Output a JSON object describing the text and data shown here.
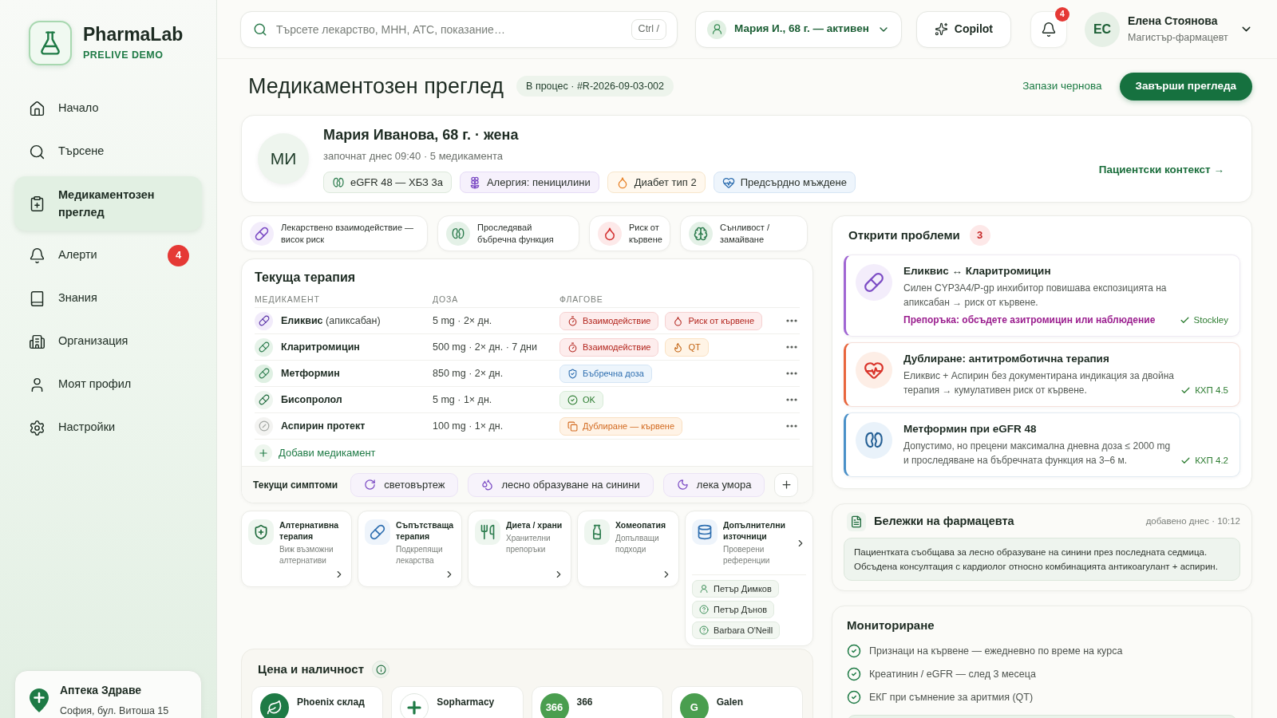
{
  "sidebar": {
    "brand": {
      "name": "PharmaLab",
      "tagline": "PRELIVE DEMO"
    },
    "items": [
      {
        "label": "Начало",
        "selected": false
      },
      {
        "label": "Търсене",
        "selected": false
      },
      {
        "label": "Медикаментозен преглед",
        "selected": true
      },
      {
        "label": "Алерти",
        "selected": false,
        "badge": "4"
      },
      {
        "label": "Знания",
        "selected": false
      },
      {
        "label": "Организация",
        "selected": false
      },
      {
        "label": "Моят профил",
        "selected": false
      },
      {
        "label": "Настройки",
        "selected": false
      }
    ],
    "pharmacy": {
      "name": "Аптека Здраве",
      "address": "София, бул. Витоша 15"
    }
  },
  "topbar": {
    "search": {
      "placeholder": "Търсете лекарство, МНН, АТС, показание…",
      "shortcut": "Ctrl /"
    },
    "patient_selector": "Мария И., 68 г. — активен",
    "copilot": "Copilot",
    "notifications": "4",
    "user": {
      "initials": "ЕС",
      "name": "Елена Стоянова",
      "role": "Магистър-фармацевт"
    }
  },
  "header": {
    "title": "Медикаментозен преглед",
    "status": "В процес · #R-2026-09-03-002",
    "save_draft": "Запази чернова",
    "finish": "Завърши прегледа"
  },
  "patient": {
    "initials": "МИ",
    "name": "Мария Иванова, 68 г. · жена",
    "meta": "започнат днес 09:40 · 5 медикамента",
    "tags": [
      {
        "kind": "renal",
        "label": "eGFR 48 — ХБЗ 3а"
      },
      {
        "kind": "allergy",
        "label": "Алергия: пеницилини"
      },
      {
        "kind": "diabetes",
        "label": "Диабет тип 2"
      },
      {
        "kind": "cardiac",
        "label": "Предсърдно мъждене"
      }
    ],
    "context_link": "Пациентски контекст →"
  },
  "alerts": [
    {
      "kind": "interaction",
      "label": "Лекарствено взаимодействие — висок риск"
    },
    {
      "kind": "renal",
      "label": "Проследявай бъбречна функция"
    },
    {
      "kind": "bleeding",
      "label": "Риск от кървене"
    },
    {
      "kind": "sedation",
      "label": "Сънливост / замайване"
    }
  ],
  "therapy": {
    "title": "Текуща терапия",
    "columns": [
      "МЕДИКАМЕНТ",
      "ДОЗА",
      "ФЛАГОВЕ"
    ],
    "rows": [
      {
        "name": "Еликвис",
        "generic": "(апиксабан)",
        "dose": "5 mg · 2× дн.",
        "flags": [
          {
            "kind": "interaction",
            "label": "Взаимодействие"
          },
          {
            "kind": "bleeding",
            "label": "Риск от кървене"
          }
        ]
      },
      {
        "name": "Кларитромицин",
        "dose": "500 mg · 2× дн. · 7 дни",
        "flags": [
          {
            "kind": "interaction",
            "label": "Взаимодействие"
          },
          {
            "kind": "qt",
            "label": "QT"
          }
        ]
      },
      {
        "name": "Метформин",
        "dose": "850 mg · 2× дн.",
        "flags": [
          {
            "kind": "renal",
            "label": "Бъбречна доза"
          }
        ]
      },
      {
        "name": "Бисопролол",
        "dose": "5 mg · 1× дн.",
        "flags": [
          {
            "kind": "ok",
            "label": "OK"
          }
        ]
      },
      {
        "name": "Аспирин протект",
        "dose": "100 mg · 1× дн.",
        "flags": [
          {
            "kind": "duplicate",
            "label": "Дублиране — кървене"
          }
        ]
      }
    ],
    "add_label": "Добави медикамент",
    "symptoms": {
      "label": "Текущи симптоми",
      "items": [
        {
          "kind": "dizziness",
          "label": "световъртеж"
        },
        {
          "kind": "bruising",
          "label": "лесно образуване на синини"
        },
        {
          "kind": "fatigue",
          "label": "лека умора"
        }
      ]
    }
  },
  "categories": [
    {
      "kind": "alternative",
      "title": "Алтернативна терапия",
      "subtitle": "Виж възможни алтернативи"
    },
    {
      "kind": "supportive",
      "title": "Съпътстваща терапия",
      "subtitle": "Подкрепящи лекарства"
    },
    {
      "kind": "diet",
      "title": "Диета / храни",
      "subtitle": "Хранителни препоръки"
    },
    {
      "kind": "homeopathy",
      "title": "Хомеопатия",
      "subtitle": "Допълващи подходи"
    },
    {
      "kind": "sources",
      "title": "Допълнителни източници",
      "subtitle": "Проверени референции",
      "people": [
        {
          "kind": "person",
          "name": "Петър Димков"
        },
        {
          "kind": "unknown",
          "name": "Петър Дънов"
        },
        {
          "kind": "unknown",
          "name": "Barbara O'Neill"
        }
      ]
    }
  ],
  "pricing": {
    "title": "Цена и наличност",
    "suppliers": [
      {
        "name": "Phoenix склад",
        "logo": {
          "kind": "leaf"
        }
      },
      {
        "name": "Sopharmacy",
        "logo": {
          "kind": "cross"
        }
      },
      {
        "name": "366",
        "logo": {
          "kind": "text",
          "text": "366"
        }
      },
      {
        "name": "Galen",
        "logo": {
          "kind": "text",
          "text": "G"
        }
      }
    ]
  },
  "issues": {
    "title": "Открити проблеми",
    "count": "3",
    "items": [
      {
        "kind": "interaction",
        "title": "Еликвис ↔ Кларитромицин",
        "description": "Силен CYP3A4/P-gp инхибитор повишава експозицията на апиксабан → риск от кървене.",
        "recommendation": "Препоръка: обсъдете азитромицин или наблюдение",
        "source": "Stockley"
      },
      {
        "kind": "duplicate",
        "title": "Дублиране: антитромботична терапия",
        "description": "Еликвис + Аспирин без документирана индикация за двойна терапия → кумулативен риск от кървене.",
        "source": "КХП 4.5"
      },
      {
        "kind": "dosing",
        "title": "Метформин при eGFR 48",
        "description": "Допустимо, но прецени максимална дневна доза ≤ 2000 mg и проследяване на бъбречната функция на 3–6 м.",
        "source": "КХП 4.2"
      }
    ]
  },
  "notes": {
    "title": "Бележки на фармацевта",
    "time": "добавено днес · 10:12",
    "text": "Пациентката съобщава за лесно образуване на синини през последната седмица. Обсъдена консултация с кардиолог относно комбинацията антикоагулант + аспирин."
  },
  "monitoring": {
    "title": "Мониториране",
    "items": [
      "Признаци на кървене — ежедневно по време на курса",
      "Креатинин / eGFR — след 3 месеца",
      "ЕКГ при съмнение за аритмия (QT)"
    ]
  }
}
